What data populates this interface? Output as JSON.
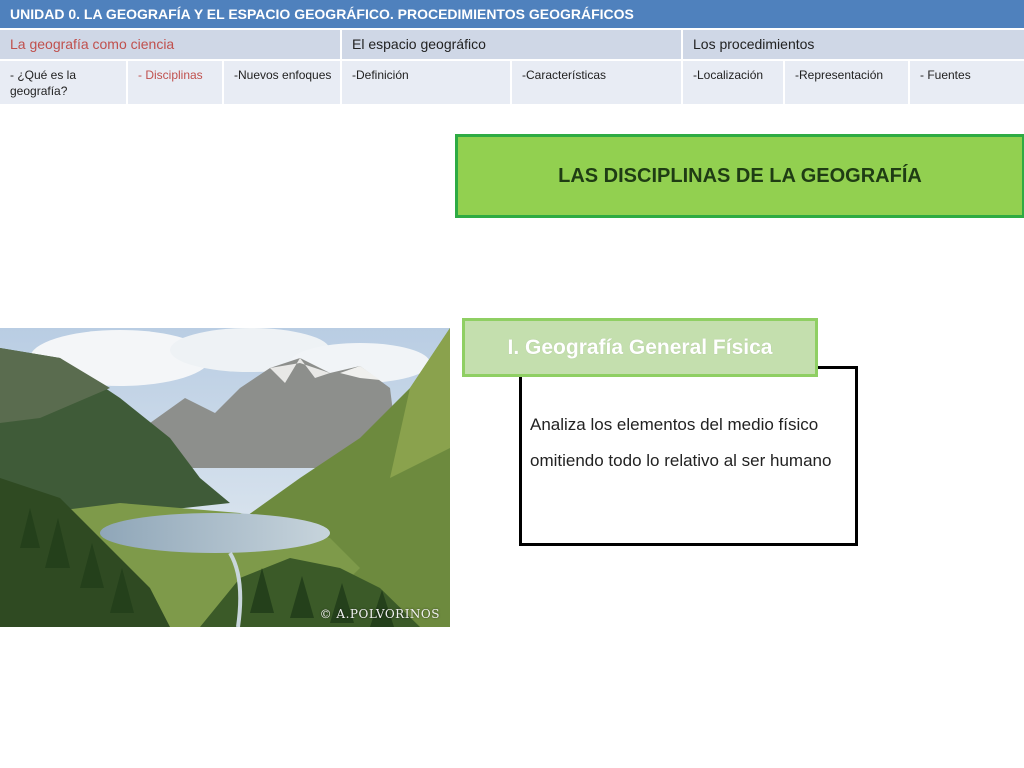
{
  "nav": {
    "title": "UNIDAD 0.  LA GEOGRAFÍA Y EL ESPACIO GEOGRÁFICO. PROCEDIMIENTOS GEOGRÁFICOS",
    "sections": [
      {
        "label": "La geografía como ciencia",
        "active": true
      },
      {
        "label": "El espacio geográfico",
        "active": false
      },
      {
        "label": "Los procedimientos",
        "active": false
      }
    ],
    "subsections": [
      {
        "label": "-  ¿Qué es la geografía?",
        "active": false
      },
      {
        "label": "- Disciplinas",
        "active": true
      },
      {
        "label": "-Nuevos enfoques",
        "active": false
      },
      {
        "label": "-Definición",
        "active": false
      },
      {
        "label": "-Características",
        "active": false
      },
      {
        "label": "-Localización",
        "active": false
      },
      {
        "label": "-Representación",
        "active": false
      },
      {
        "label": "- Fuentes",
        "active": false
      }
    ]
  },
  "banner": {
    "title": "LAS DISCIPLINAS DE LA GEOGRAFÍA"
  },
  "photo": {
    "copyright": "© A.POLVORINOS",
    "icon": "landscape-photo"
  },
  "discipline": {
    "label": "I. Geografía General Física",
    "description": "Analiza los elementos del medio físico omitiendo todo lo relativo al ser humano"
  },
  "colors": {
    "header_blue": "#4f81bd",
    "active_red": "#c0504d",
    "banner_green": "#92d050",
    "banner_border": "#2eab43"
  }
}
